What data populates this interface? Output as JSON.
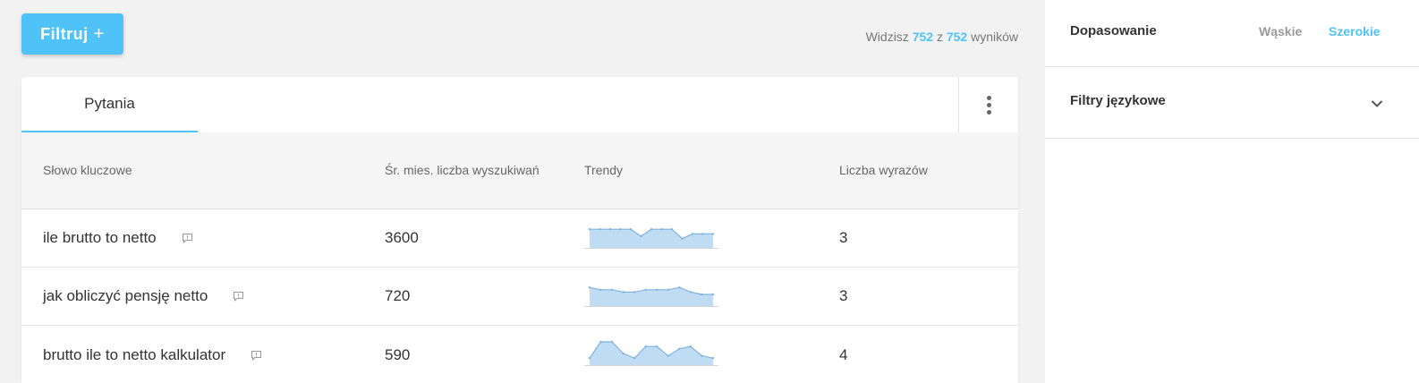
{
  "toolbar": {
    "filter_label": "Filtruj",
    "filter_plus": "+"
  },
  "results": {
    "prefix": "Widzisz",
    "shown": "752",
    "sep": "z",
    "total": "752",
    "suffix": "wyników"
  },
  "tabs": [
    {
      "label": "Pytania",
      "active": true
    }
  ],
  "table": {
    "headers": {
      "keyword": "Słowo kluczowe",
      "volume": "Śr. mies. liczba wyszukiwań",
      "trends": "Trendy",
      "words": "Liczba wyrazów"
    },
    "rows": [
      {
        "keyword": "ile brutto to netto",
        "volume": "3600",
        "words": "3",
        "trend": [
          8,
          8,
          8,
          8,
          8,
          5,
          8,
          8,
          8,
          4,
          6,
          6,
          6
        ]
      },
      {
        "keyword": "jak obliczyć pensję netto",
        "volume": "720",
        "words": "3",
        "trend": [
          8,
          7,
          7,
          6,
          6,
          7,
          7,
          7,
          8,
          6,
          5,
          5
        ]
      },
      {
        "keyword": "brutto ile to netto kalkulator",
        "volume": "590",
        "words": "4",
        "trend": [
          3,
          10,
          10,
          5,
          3,
          8,
          8,
          4,
          7,
          8,
          4,
          3
        ]
      }
    ]
  },
  "sidebar": {
    "match": {
      "title": "Dopasowanie",
      "option_narrow": "Wąskie",
      "option_broad": "Szerokie",
      "selected": "Szerokie"
    },
    "language": {
      "title": "Filtry językowe"
    }
  },
  "colors": {
    "accent": "#4fc3f7",
    "spark_fill": "#bfdcf3",
    "spark_line": "#7fb3e0"
  },
  "icons": {
    "feedback": "feedback-icon",
    "more": "more-vertical-icon",
    "chevron": "chevron-down-icon"
  }
}
